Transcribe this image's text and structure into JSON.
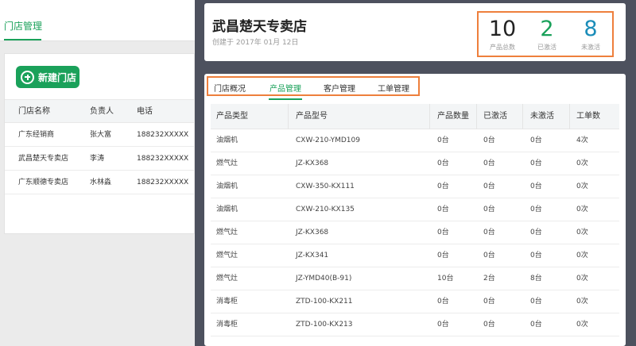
{
  "left": {
    "tab_label": "门店管理",
    "new_button_label": "新建门店",
    "columns": [
      "门店名称",
      "负责人",
      "电话"
    ],
    "rows": [
      [
        "广东经销商",
        "张大富",
        "188232XXXXX"
      ],
      [
        "武昌楚天专卖店",
        "李涛",
        "188232XXXXX"
      ],
      [
        "广东顺德专卖店",
        "水林淼",
        "188232XXXXX"
      ]
    ]
  },
  "store": {
    "name": "武昌楚天专卖店",
    "created": "创建于 2017年 01月 12日"
  },
  "stats": [
    {
      "value": "10",
      "label": "产品总数"
    },
    {
      "value": "2",
      "label": "已激活"
    },
    {
      "value": "8",
      "label": "未激活"
    }
  ],
  "tabs": [
    "门店概况",
    "产品管理",
    "客户管理",
    "工单管理"
  ],
  "products": {
    "columns": [
      "产品类型",
      "产品型号",
      "产品数量",
      "已激活",
      "未激活",
      "工单数"
    ],
    "rows": [
      [
        "油烟机",
        "CXW-210-YMD109",
        "0台",
        "0台",
        "0台",
        "4次"
      ],
      [
        "燃气灶",
        "JZ-KX368",
        "0台",
        "0台",
        "0台",
        "0次"
      ],
      [
        "油烟机",
        "CXW-350-KX111",
        "0台",
        "0台",
        "0台",
        "0次"
      ],
      [
        "油烟机",
        "CXW-210-KX135",
        "0台",
        "0台",
        "0台",
        "0次"
      ],
      [
        "燃气灶",
        "JZ-KX368",
        "0台",
        "0台",
        "0台",
        "0次"
      ],
      [
        "燃气灶",
        "JZ-KX341",
        "0台",
        "0台",
        "0台",
        "0次"
      ],
      [
        "燃气灶",
        "JZ-YMD40(B-91)",
        "10台",
        "2台",
        "8台",
        "0次"
      ],
      [
        "消毒柜",
        "ZTD-100-KX211",
        "0台",
        "0台",
        "0台",
        "0次"
      ],
      [
        "消毒柜",
        "ZTD-100-KX213",
        "0台",
        "0台",
        "0台",
        "0次"
      ]
    ]
  },
  "colors": {
    "accent": "#1aa15a",
    "highlight": "#ee7f3c",
    "blue": "#1b8db9",
    "sidebar_dark": "#4d515e"
  }
}
